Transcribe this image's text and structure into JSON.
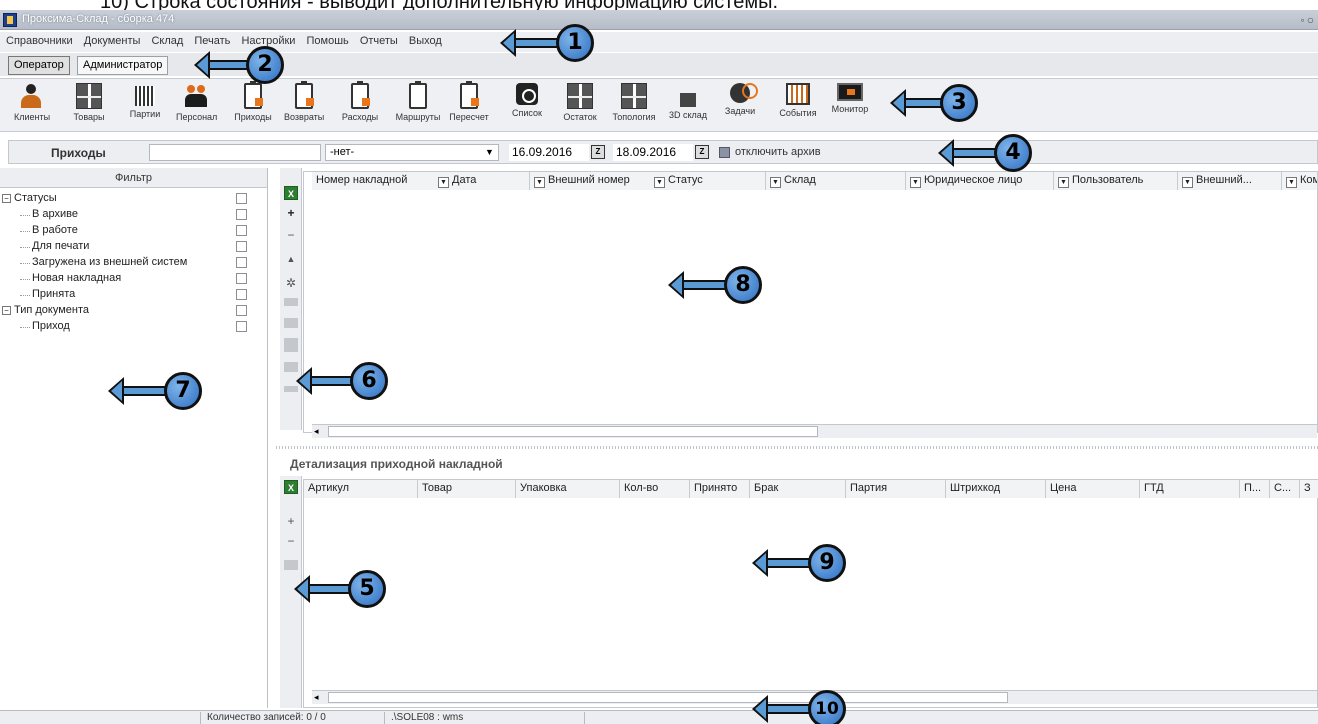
{
  "doc_text": "10) Строка состояния - выводит дополнительную информацию системы.",
  "window": {
    "title": "Проксима-Склад - сборка 474"
  },
  "menu": [
    "Справочники",
    "Документы",
    "Склад",
    "Печать",
    "Настройки",
    "Помошь",
    "Отчеты",
    "Выход"
  ],
  "roles": {
    "operator": "Оператор",
    "admin": "Администратор"
  },
  "toolbar": [
    {
      "label": "Клиенты",
      "icon": "clients-icon"
    },
    {
      "label": "Товары",
      "icon": "goods-icon"
    },
    {
      "label": "Партии",
      "icon": "batches-icon"
    },
    {
      "label": "Персонал",
      "icon": "staff-icon"
    },
    {
      "label": "Приходы",
      "icon": "incoming-icon"
    },
    {
      "label": "Возвраты",
      "icon": "returns-icon"
    },
    {
      "label": "Расходы",
      "icon": "outgoing-icon"
    },
    {
      "label": "Маршруты",
      "icon": "routes-icon"
    },
    {
      "label": "Пересчет",
      "icon": "recount-icon"
    },
    {
      "label": "Список",
      "icon": "list-icon"
    },
    {
      "label": "Остаток",
      "icon": "balance-icon"
    },
    {
      "label": "Топология",
      "icon": "topology-icon"
    },
    {
      "label": "3D склад",
      "icon": "warehouse-3d-icon"
    },
    {
      "label": "Задачи",
      "icon": "tasks-icon"
    },
    {
      "label": "События",
      "icon": "events-icon"
    },
    {
      "label": "Монитор",
      "icon": "monitor-icon"
    }
  ],
  "filterbar": {
    "title": "Приходы",
    "search_value": "",
    "select_value": "-нет-",
    "date_from": "16.09.2016",
    "date_to": "18.09.2016",
    "archive_label": "отключить архив"
  },
  "filter_panel": {
    "header": "Фильтр",
    "groups": [
      {
        "label": "Статусы",
        "items": [
          "В архиве",
          "В работе",
          "Для печати",
          "Загружена из внешней систем",
          "Новая накладная",
          "Принята"
        ]
      },
      {
        "label": "Тип документа",
        "items": [
          "Приход"
        ]
      }
    ]
  },
  "main_grid": {
    "columns": [
      "Номер накладной",
      "Дата",
      "Внешний номер",
      "Статус",
      "Склад",
      "Юридическое лицо",
      "Пользователь",
      "Внешний...",
      "Ком"
    ]
  },
  "detail": {
    "title": "Детализация приходной накладной",
    "columns": [
      "Артикул",
      "Товар",
      "Упаковка",
      "Кол-во",
      "Принято",
      "Брак",
      "Партия",
      "Штрихкод",
      "Цена",
      "ГТД",
      "П...",
      "С...",
      "З"
    ]
  },
  "status": {
    "count": "Количество записей: 0 / 0",
    "db": ".\\SOLE08 : wms"
  },
  "callouts": [
    "1",
    "2",
    "3",
    "4",
    "5",
    "6",
    "7",
    "8",
    "9",
    "10"
  ],
  "colors": {
    "callout_fill": "#5b9bd5",
    "toolbar_accent": "#e8761c"
  }
}
